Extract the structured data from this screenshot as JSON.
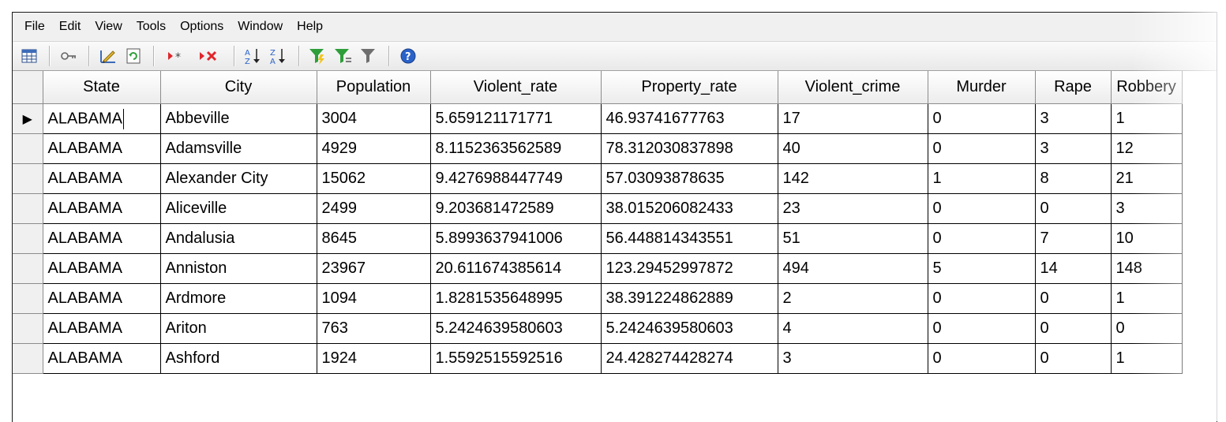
{
  "menu": [
    "File",
    "Edit",
    "View",
    "Tools",
    "Options",
    "Window",
    "Help"
  ],
  "toolbar": {
    "icons": [
      "form-view-icon",
      "primary-key-icon",
      "edit-query-icon",
      "refresh-icon",
      "new-record-icon",
      "delete-record-icon",
      "sort-ascending-icon",
      "sort-descending-icon",
      "filter-wizard-icon",
      "custom-filter-icon",
      "filter-icon",
      "help-icon"
    ]
  },
  "grid": {
    "columns": [
      "State",
      "City",
      "Population",
      "Violent_rate",
      "Property_rate",
      "Violent_crime",
      "Murder",
      "Rape",
      "Robbery"
    ],
    "current_row_marker": "▶",
    "rows": [
      [
        "ALABAMA",
        "Abbeville",
        "3004",
        "5.659121171771",
        "46.93741677763",
        "17",
        "0",
        "3",
        "1"
      ],
      [
        "ALABAMA",
        "Adamsville",
        "4929",
        "8.1152363562589",
        "78.312030837898",
        "40",
        "0",
        "3",
        "12"
      ],
      [
        "ALABAMA",
        "Alexander City",
        "15062",
        "9.4276988447749",
        "57.03093878635",
        "142",
        "1",
        "8",
        "21"
      ],
      [
        "ALABAMA",
        "Aliceville",
        "2499",
        "9.203681472589",
        "38.015206082433",
        "23",
        "0",
        "0",
        "3"
      ],
      [
        "ALABAMA",
        "Andalusia",
        "8645",
        "5.8993637941006",
        "56.448814343551",
        "51",
        "0",
        "7",
        "10"
      ],
      [
        "ALABAMA",
        "Anniston",
        "23967",
        "20.611674385614",
        "123.29452997872",
        "494",
        "5",
        "14",
        "148"
      ],
      [
        "ALABAMA",
        "Ardmore",
        "1094",
        "1.8281535648995",
        "38.391224862889",
        "2",
        "0",
        "0",
        "1"
      ],
      [
        "ALABAMA",
        "Ariton",
        "763",
        "5.2424639580603",
        "5.2424639580603",
        "4",
        "0",
        "0",
        "0"
      ],
      [
        "ALABAMA",
        "Ashford",
        "1924",
        "1.5592515592516",
        "24.428274428274",
        "3",
        "0",
        "0",
        "1"
      ]
    ]
  },
  "colors": {
    "accent_red": "#e0262b",
    "filter_green": "#2e9e3a",
    "help_blue": "#2a62c9"
  }
}
